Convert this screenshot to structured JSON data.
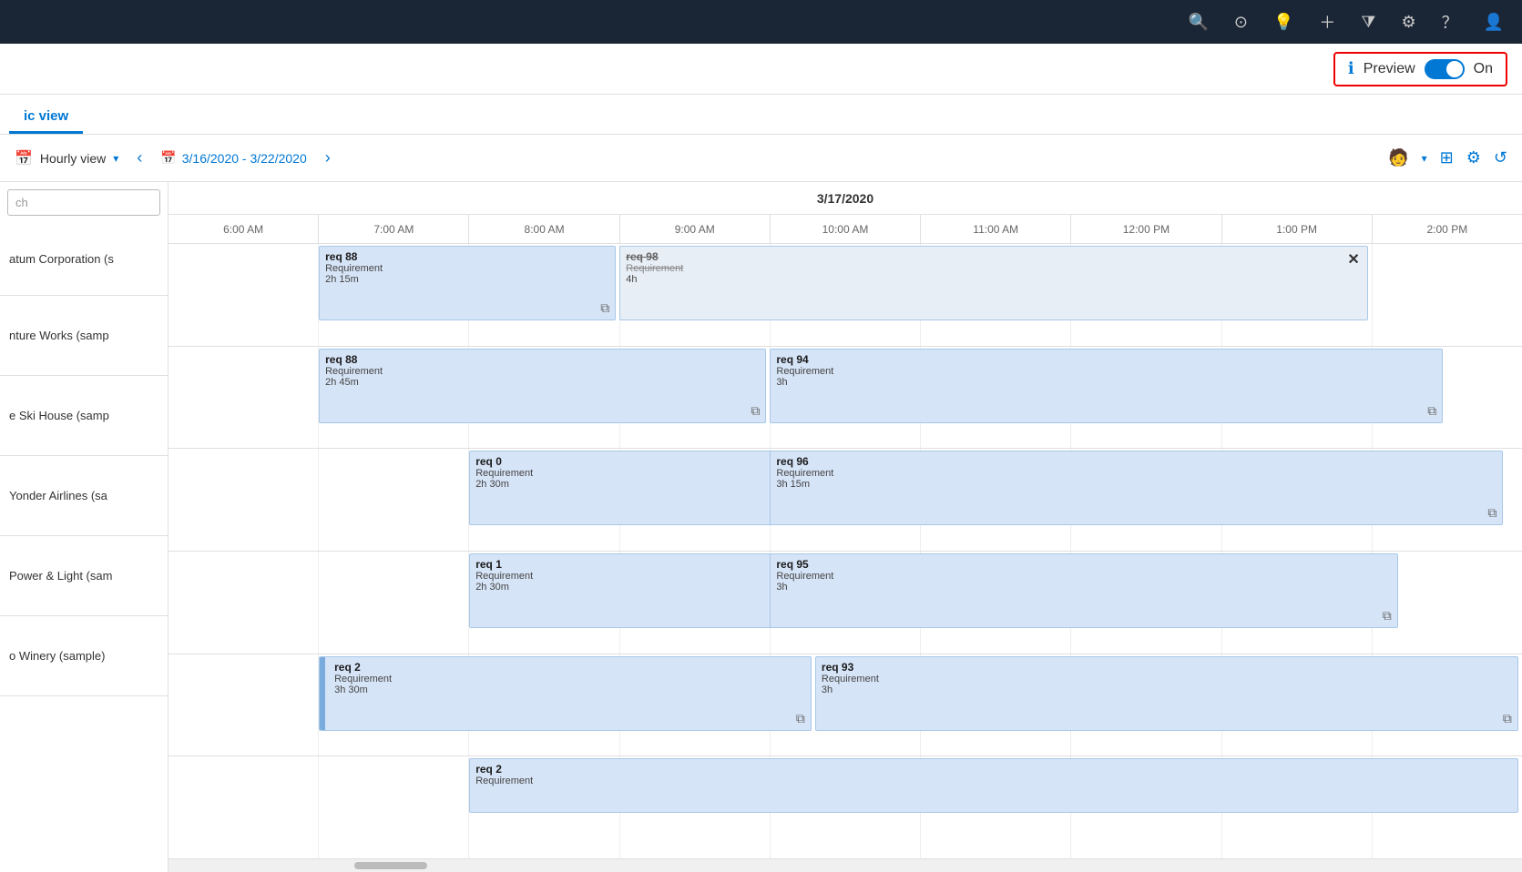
{
  "topnav": {
    "icons": [
      "search",
      "check-circle",
      "lightbulb",
      "plus",
      "filter",
      "gear",
      "question",
      "user"
    ]
  },
  "preview": {
    "label": "Preview",
    "on_label": "On",
    "info_icon": "ℹ"
  },
  "tabs": [
    {
      "id": "board",
      "label": "ic view",
      "active": true
    }
  ],
  "toolbar": {
    "hourly_view_label": "Hourly view",
    "date_range": "3/16/2020 - 3/22/2020",
    "calendar_icon": "📅"
  },
  "sidebar": {
    "search_placeholder": "ch",
    "rows": [
      {
        "label": "atum Corporation (s"
      },
      {
        "label": "nture Works (samp"
      },
      {
        "label": "e Ski House (samp"
      },
      {
        "label": "Yonder Airlines (sa"
      },
      {
        "label": "Power & Light (sam"
      },
      {
        "label": "o Winery (sample)"
      }
    ]
  },
  "calendar": {
    "date_header": "3/17/2020",
    "time_slots": [
      "6:00 AM",
      "7:00 AM",
      "8:00 AM",
      "9:00 AM",
      "10:00 AM",
      "11:00 AM",
      "12:00 PM",
      "1:00 PM",
      "2:00 PM"
    ]
  },
  "requirements": [
    {
      "id": "req88a",
      "title": "req 88",
      "subtitle": "Requirement",
      "duration": "2h 15m",
      "row": 0,
      "col_start": 1,
      "col_span": 2,
      "strikethrough": false,
      "has_icon": true
    },
    {
      "id": "req98",
      "title": "req 98",
      "subtitle": "Requirement",
      "duration": "4h",
      "row": 0,
      "col_start": 3,
      "col_span": 4,
      "strikethrough": true,
      "has_close": true
    },
    {
      "id": "req88b",
      "title": "req 88",
      "subtitle": "Requirement",
      "duration": "2h 45m",
      "row": 1,
      "col_start": 1,
      "col_span": 3,
      "strikethrough": false,
      "has_icon": true
    },
    {
      "id": "req94",
      "title": "req 94",
      "subtitle": "Requirement",
      "duration": "3h",
      "row": 1,
      "col_start": 4,
      "col_span": 4,
      "strikethrough": false,
      "has_icon": true
    },
    {
      "id": "req0",
      "title": "req 0",
      "subtitle": "Requirement",
      "duration": "2h 30m",
      "row": 2,
      "col_start": 2,
      "col_span": 3,
      "strikethrough": false,
      "has_icon": true
    },
    {
      "id": "req96",
      "title": "req 96",
      "subtitle": "Requirement",
      "duration": "3h 15m",
      "row": 2,
      "col_start": 4,
      "col_span": 4,
      "strikethrough": false,
      "has_icon": true
    },
    {
      "id": "req1",
      "title": "req 1",
      "subtitle": "Requirement",
      "duration": "2h 30m",
      "row": 3,
      "col_start": 2,
      "col_span": 3,
      "strikethrough": false,
      "has_icon": true
    },
    {
      "id": "req95",
      "title": "req 95",
      "subtitle": "Requirement",
      "duration": "3h",
      "row": 3,
      "col_start": 4,
      "col_span": 4,
      "strikethrough": false,
      "has_icon": true
    },
    {
      "id": "req2a",
      "title": "req 2",
      "subtitle": "Requirement",
      "duration": "3h 30m",
      "row": 4,
      "col_start": 1,
      "col_span": 4,
      "strikethrough": false,
      "has_icon": true,
      "has_drag": true
    },
    {
      "id": "req93",
      "title": "req 93",
      "subtitle": "Requirement",
      "duration": "3h",
      "row": 4,
      "col_start": 4,
      "col_span": 4,
      "strikethrough": false,
      "has_icon": true
    },
    {
      "id": "req2b",
      "title": "req 2",
      "subtitle": "Requirement",
      "duration": "",
      "row": 5,
      "col_start": 2,
      "col_span": 6,
      "strikethrough": false,
      "has_icon": false
    }
  ]
}
